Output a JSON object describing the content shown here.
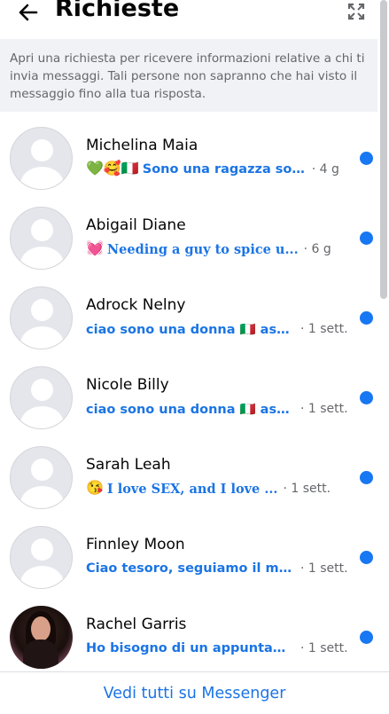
{
  "header": {
    "title": "Richieste",
    "back_icon": "back-arrow-icon",
    "expand_icon": "expand-icon"
  },
  "notice": {
    "text": "Apri una richiesta per ricevere informazioni relative a chi ti invia messaggi. Tali persone non sapranno che hai visto il messaggio fino alla tua risposta."
  },
  "requests": [
    {
      "name": "Michelina Maia",
      "emoji": "💚🥰🇮🇹",
      "snippet": "Sono una ragazza sola ...",
      "time": "· 4 g",
      "unread": true,
      "avatar": "default"
    },
    {
      "name": "Abigail Diane",
      "emoji": "💓",
      "snippet": "Needing a guy to spice u...",
      "time": "· 6 g",
      "unread": true,
      "avatar": "default"
    },
    {
      "name": "Adrock Nelny",
      "emoji": "",
      "snippet": "ciao sono una donna 🇮🇹 asset...",
      "time": "· 1 sett.",
      "unread": true,
      "avatar": "default"
    },
    {
      "name": "Nicole Billy",
      "emoji": "",
      "snippet": "ciao sono una donna 🇮🇹 asset...",
      "time": "· 1 sett.",
      "unread": true,
      "avatar": "default"
    },
    {
      "name": "Sarah Leah",
      "emoji": "😘",
      "snippet": "I love SEX, and I love ...",
      "time": "· 1 sett.",
      "unread": true,
      "avatar": "default"
    },
    {
      "name": "Finnley Moon",
      "emoji": "",
      "snippet": "Ciao tesoro, seguiamo il mio li...",
      "time": "· 1 sett.",
      "unread": true,
      "avatar": "default"
    },
    {
      "name": "Rachel Garris",
      "emoji": "",
      "snippet": "Ho bisogno di un appuntame...",
      "time": "· 1 sett.",
      "unread": true,
      "avatar": "photo"
    }
  ],
  "footer": {
    "link": "Vedi tutti su Messenger"
  },
  "colors": {
    "accent": "#1b74e4",
    "unread_dot": "#1877f2",
    "notice_bg": "#f0f2f5",
    "secondary_text": "#65676b"
  }
}
